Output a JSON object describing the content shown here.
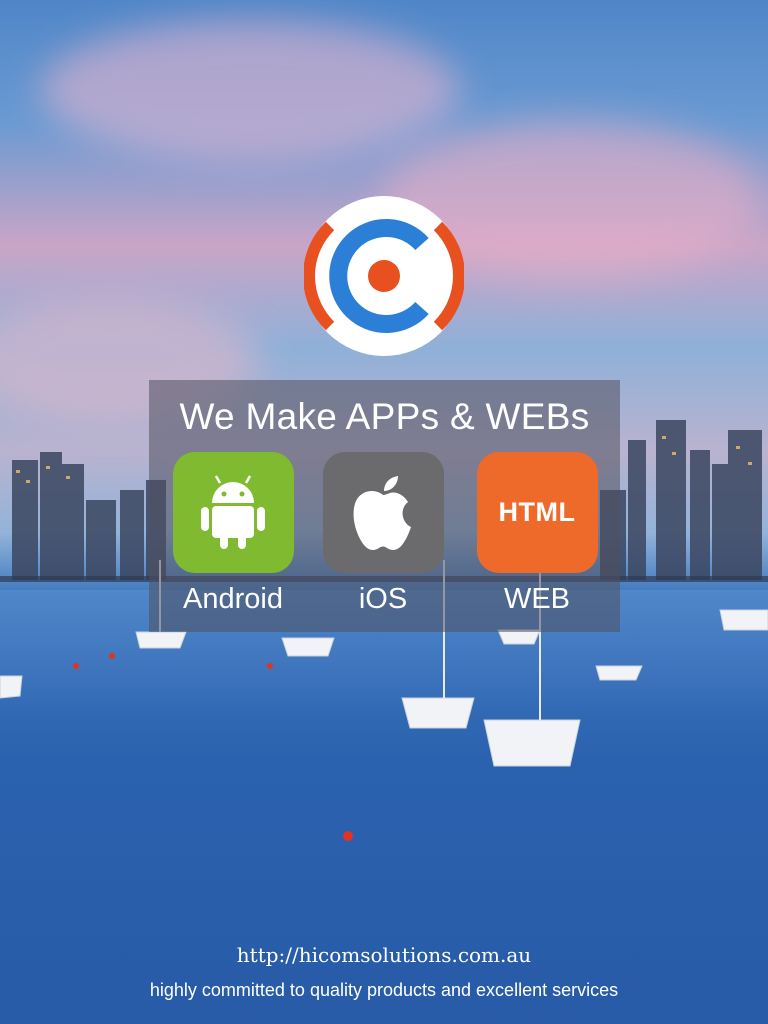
{
  "logo": {
    "icon": "company-logo-icon",
    "colors": {
      "ring": "#e8501f",
      "letter": "#2c7fd6",
      "center": "#e8501f",
      "background": "#ffffff"
    }
  },
  "panel": {
    "headline": "We Make APPs & WEBs",
    "platforms": [
      {
        "label": "Android",
        "icon": "android-icon",
        "color": "#7fba31"
      },
      {
        "label": "iOS",
        "icon": "apple-icon",
        "color": "#6b6b6d"
      },
      {
        "label": "WEB",
        "icon": "html-icon",
        "icon_text": "HTML",
        "color": "#ee6a2b"
      }
    ]
  },
  "footer": {
    "url": "http://hicomsolutions.com.au",
    "tagline": "highly committed to quality products and excellent services"
  }
}
